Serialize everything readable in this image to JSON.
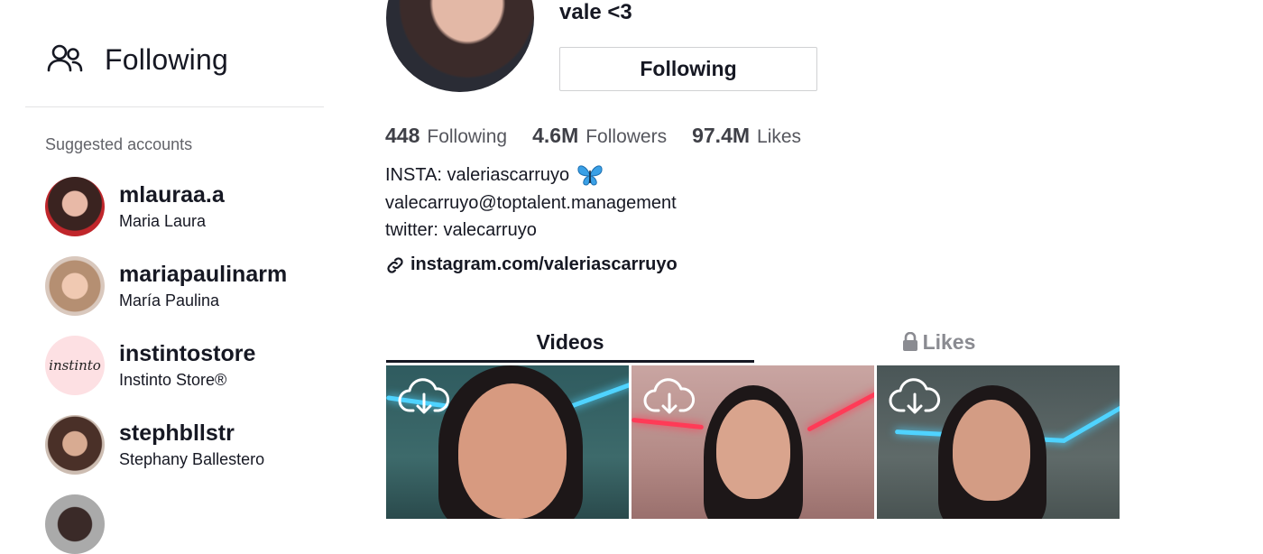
{
  "sidebar": {
    "following_label": "Following",
    "suggested_title": "Suggested accounts",
    "accounts": [
      {
        "username": "mlauraa.a",
        "display_name": "Maria Laura"
      },
      {
        "username": "mariapaulinarm",
        "display_name": "María Paulina"
      },
      {
        "username": "instintostore",
        "display_name": "Instinto Store®",
        "avatar_text": "instinto"
      },
      {
        "username": "stephbllstr",
        "display_name": "Stephany Ballestero"
      }
    ]
  },
  "profile": {
    "name": "vale <3",
    "follow_button": "Following",
    "stats": {
      "following_count": "448",
      "following_label": "Following",
      "followers_count": "4.6M",
      "followers_label": "Followers",
      "likes_count": "97.4M",
      "likes_label": "Likes"
    },
    "bio": {
      "line1": "INSTA: valeriascarruyo",
      "line1_emoji": "🦋",
      "line2": "valecarruyo@toptalent.management",
      "line3": "twitter: valecarruyo"
    },
    "link": "instagram.com/valeriascarruyo"
  },
  "tabs": {
    "videos": "Videos",
    "likes": "Likes"
  },
  "icons": {
    "following": "people-icon",
    "link": "link-icon",
    "lock": "lock-icon",
    "download": "cloud-download-icon"
  }
}
